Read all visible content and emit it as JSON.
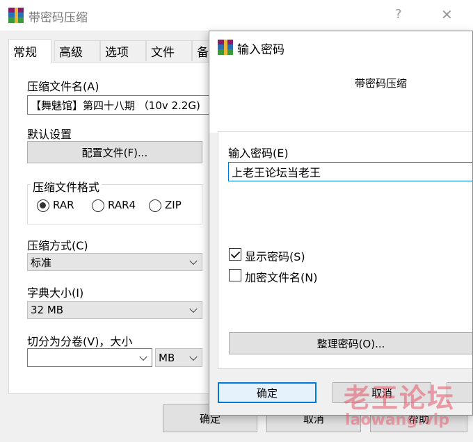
{
  "main_window": {
    "title": "带密码压缩",
    "help_glyph": "?",
    "close_glyph": "✕",
    "tabs": [
      "常规",
      "高级",
      "选项",
      "文件",
      "备"
    ],
    "archive_name_label": "压缩文件名(A)",
    "archive_name_value": "【舞魅馆】第四十八期 （10v 2.2G)",
    "default_settings_label": "默认设置",
    "profiles_button": "配置文件(F)...",
    "format_group_label": "压缩文件格式",
    "formats": [
      {
        "label": "RAR",
        "selected": true
      },
      {
        "label": "RAR4",
        "selected": false
      },
      {
        "label": "ZIP",
        "selected": false
      }
    ],
    "method_label": "压缩方式(C)",
    "method_value": "标准",
    "dict_label": "字典大小(I)",
    "dict_value": "32 MB",
    "split_label": "切分为分卷(V)，大小",
    "split_value": "",
    "split_unit": "MB",
    "ok_button": "确定",
    "cancel_button": "取消",
    "help_button": "帮助"
  },
  "password_dialog": {
    "title": "输入密码",
    "subtitle": "带密码压缩",
    "password_label": "输入密码(E)",
    "password_value": "上老王论坛当老王",
    "show_password_label": "显示密码(S)",
    "show_password_checked": true,
    "encrypt_names_label": "加密文件名(N)",
    "encrypt_names_checked": false,
    "organize_button": "整理密码(O)...",
    "ok_button": "确定",
    "cancel_button": "取消"
  },
  "watermark": {
    "line1": "老王论坛",
    "line2": "laowang.vip",
    "color": "#e8566a"
  }
}
